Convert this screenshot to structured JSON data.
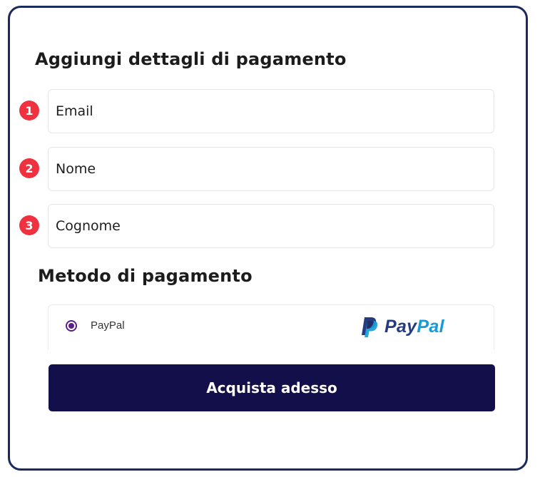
{
  "form": {
    "title": "Aggiungi dettagli di pagamento",
    "fields": [
      {
        "step": "1",
        "placeholder": "Email",
        "value": ""
      },
      {
        "step": "2",
        "placeholder": "Nome",
        "value": ""
      },
      {
        "step": "3",
        "placeholder": "Cognome",
        "value": ""
      }
    ]
  },
  "payment": {
    "title": "Metodo di pagamento",
    "option_label": "PayPal",
    "selected": true,
    "logo_text_pay": "Pay",
    "logo_text_pal": "Pal"
  },
  "submit": {
    "label": "Acquista adesso"
  },
  "colors": {
    "card_border": "#1b2a5c",
    "badge": "#f0313f",
    "radio": "#5a1e85",
    "button": "#130f4a",
    "paypal_dark": "#253b80",
    "paypal_light": "#179bd7"
  },
  "icons": {
    "paypal": "paypal-logo-icon",
    "radio": "radio-selected-icon"
  }
}
